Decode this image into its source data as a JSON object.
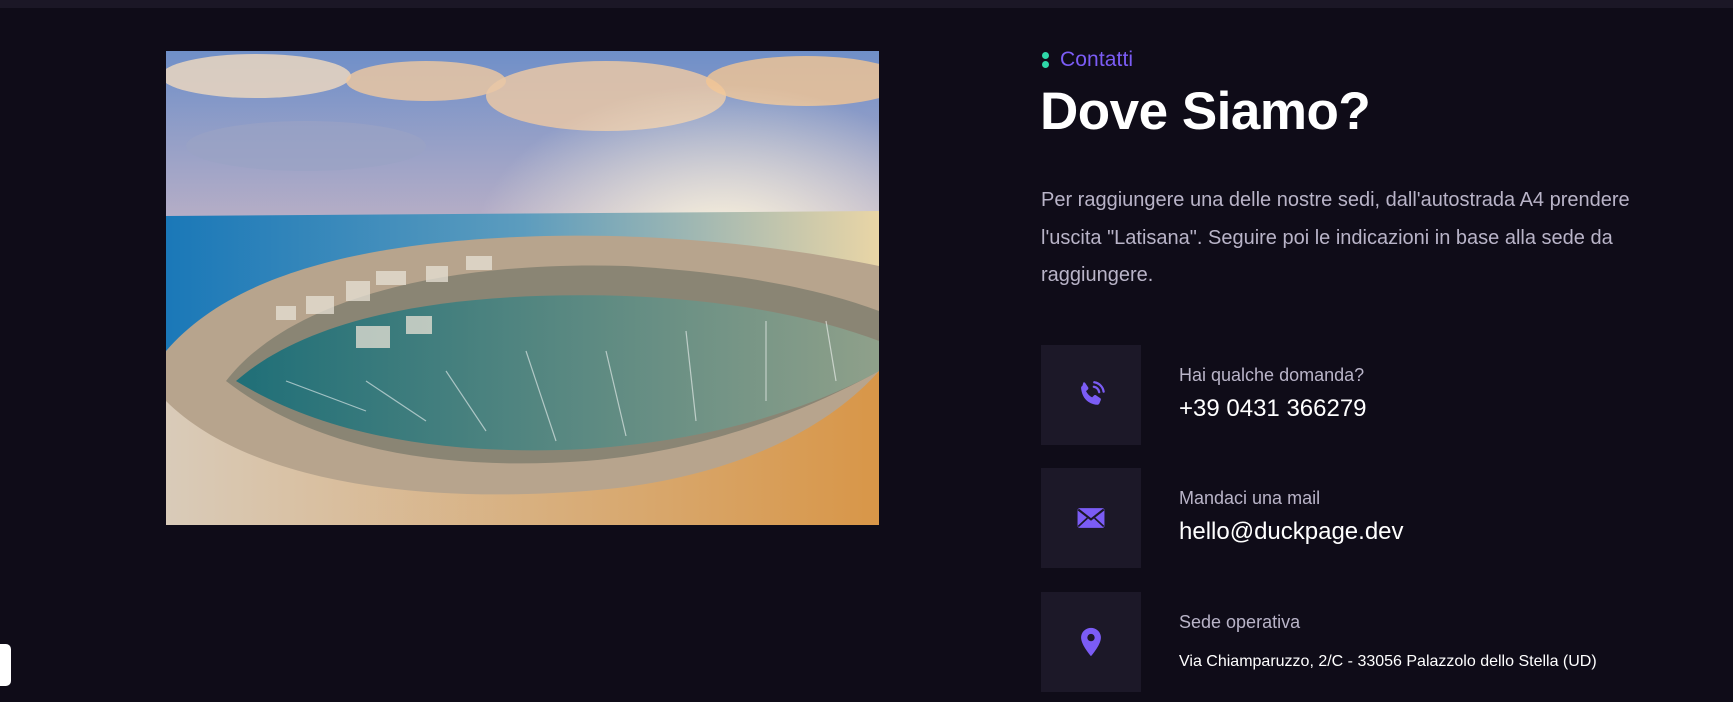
{
  "section": {
    "kicker": "Contatti",
    "title": "Dove Siamo?",
    "intro": "Per raggiungere una delle nostre sedi, dall'autostrada A4 prendere l'uscita \"Latisana\". Seguire poi le indicazioni in base alla sede da raggiungere."
  },
  "image": {
    "subject": "aerial view of a coastal marina with a curved harbor at sunset",
    "icon": "photo"
  },
  "contacts": [
    {
      "icon": "phone-icon",
      "label": "Hai qualche domanda?",
      "value": "+39 0431 366279"
    },
    {
      "icon": "mail-icon",
      "label": "Mandaci una mail",
      "value": "hello@duckpage.dev"
    },
    {
      "icon": "location-pin-icon",
      "label": "Sede operativa",
      "value": "Via Chiamparuzzo, 2/C - 33056 Palazzolo dello Stella (UD)"
    }
  ],
  "colors": {
    "background": "#0f0c18",
    "accent": "#7b5cf5",
    "kicker_dot": "#2ed8a8",
    "icon_box": "#1c1828",
    "muted_text": "#b9b4c8"
  }
}
